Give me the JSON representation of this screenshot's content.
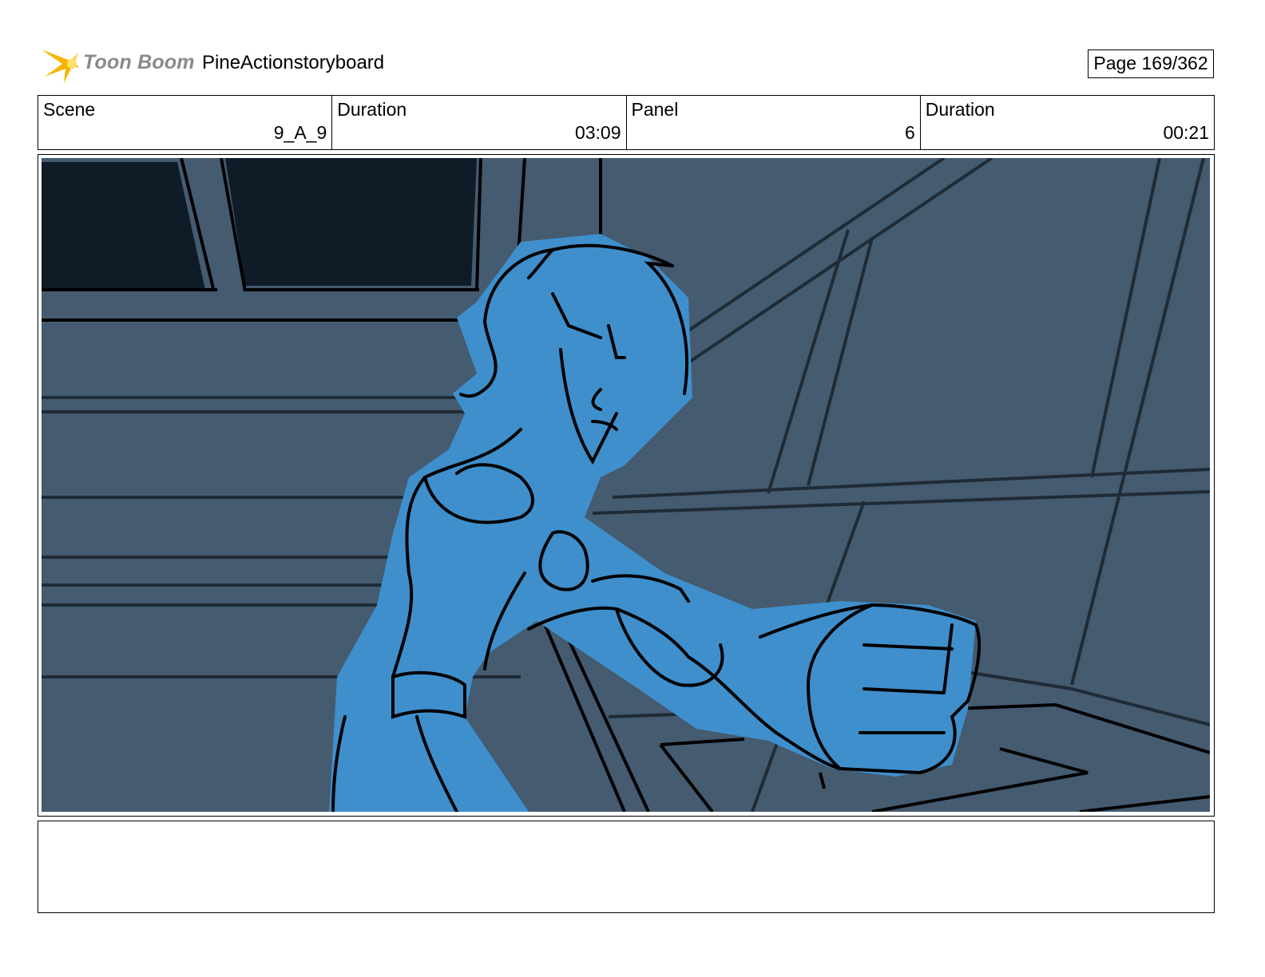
{
  "header": {
    "logo_text": "Toon Boom",
    "project_title": "PineActionstoryboard",
    "page": "Page 169/362"
  },
  "info": [
    {
      "label": "Scene",
      "value": "9_A_9"
    },
    {
      "label": "Duration",
      "value": "03:09"
    },
    {
      "label": "Panel",
      "value": "6"
    },
    {
      "label": "Duration",
      "value": "00:21"
    }
  ],
  "panel": {
    "description": "",
    "colors": {
      "background": "#445b70",
      "dark_shape": "#0f1c27",
      "character": "#3f8fcc",
      "line": "#000000"
    }
  },
  "notes": {
    "text": ""
  }
}
